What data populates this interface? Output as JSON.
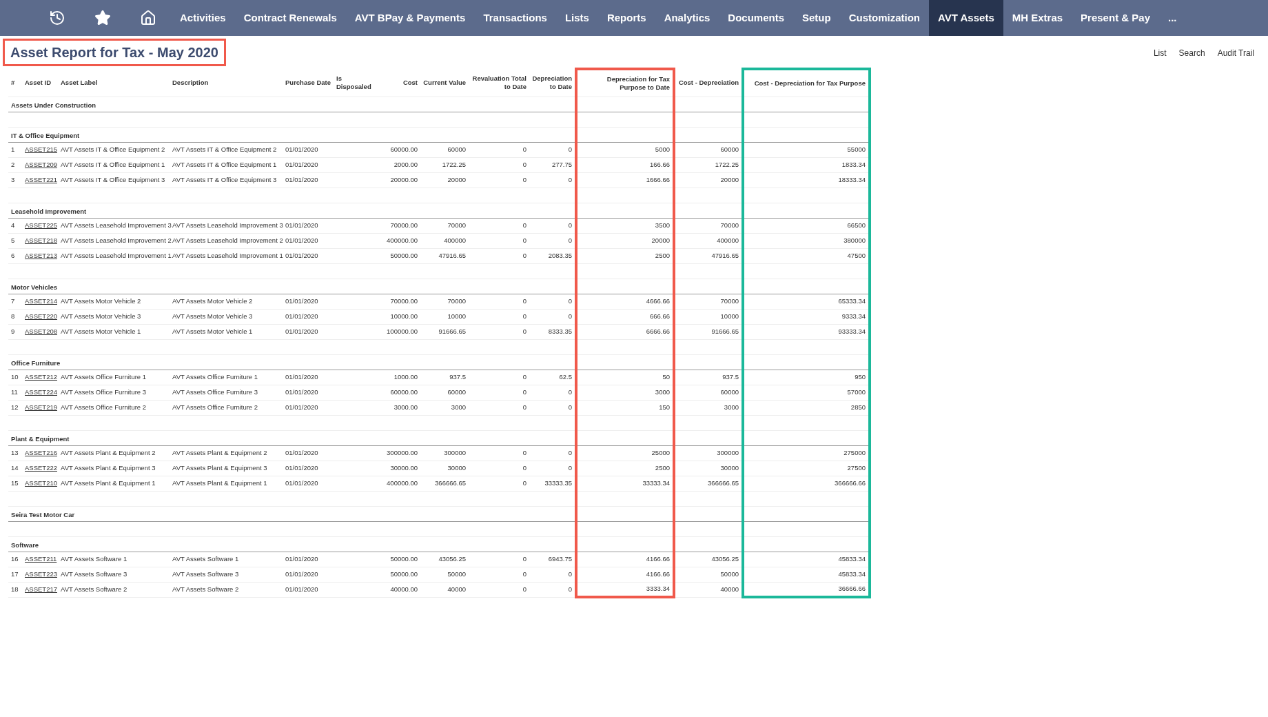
{
  "nav": {
    "icons": [
      {
        "kind": "history"
      },
      {
        "kind": "star"
      },
      {
        "kind": "home"
      }
    ],
    "items": [
      {
        "label": "Activities",
        "selected": false
      },
      {
        "label": "Contract Renewals",
        "selected": false
      },
      {
        "label": "AVT BPay & Payments",
        "selected": false
      },
      {
        "label": "Transactions",
        "selected": false
      },
      {
        "label": "Lists",
        "selected": false
      },
      {
        "label": "Reports",
        "selected": false
      },
      {
        "label": "Analytics",
        "selected": false
      },
      {
        "label": "Documents",
        "selected": false
      },
      {
        "label": "Setup",
        "selected": false
      },
      {
        "label": "Customization",
        "selected": false
      },
      {
        "label": "AVT Assets",
        "selected": true
      },
      {
        "label": "MH Extras",
        "selected": false
      },
      {
        "label": "Present & Pay",
        "selected": false
      },
      {
        "label": "...",
        "selected": false
      }
    ]
  },
  "title": {
    "text": "Asset Report for Tax - May 2020",
    "outlined": true
  },
  "links": [
    "List",
    "Search",
    "Audit Trail"
  ],
  "table": {
    "columns": [
      {
        "label": "#",
        "kind": "text"
      },
      {
        "label": "Asset ID",
        "kind": "link"
      },
      {
        "label": "Asset Label",
        "kind": "text"
      },
      {
        "label": "Description",
        "kind": "text"
      },
      {
        "label": "Purchase Date",
        "kind": "text"
      },
      {
        "label": "Is Disposaled",
        "kind": "text"
      },
      {
        "label": "Cost",
        "kind": "number"
      },
      {
        "label": "Current Value",
        "kind": "number"
      },
      {
        "label": "Revaluation Total to Date",
        "kind": "number"
      },
      {
        "label": "Depreciation to Date",
        "kind": "number"
      },
      {
        "label": "Depreciation for Tax Purpose to Date",
        "kind": "number",
        "color": "#f0594b"
      },
      {
        "label": "Cost - Depreciation",
        "kind": "number"
      },
      {
        "label": "Cost - Depreciation for Tax Purpose",
        "kind": "number",
        "color": "#1bb89a"
      }
    ],
    "groups": [
      {
        "name": "Assets Under Construction"
      },
      {
        "name": "IT & Office Equipment",
        "rows": [
          [
            "1",
            "ASSET215",
            "AVT Assets IT & Office Equipment 2",
            "AVT Assets IT & Office Equipment 2",
            "01/01/2020",
            "",
            "60000.00",
            "60000",
            "0",
            "0",
            "5000",
            "60000",
            "55000"
          ],
          [
            "2",
            "ASSET209",
            "AVT Assets IT & Office Equipment 1",
            "AVT Assets IT & Office Equipment 1",
            "01/01/2020",
            "",
            "2000.00",
            "1722.25",
            "0",
            "277.75",
            "166.66",
            "1722.25",
            "1833.34"
          ],
          [
            "3",
            "ASSET221",
            "AVT Assets IT & Office Equipment 3",
            "AVT Assets IT & Office Equipment 3",
            "01/01/2020",
            "",
            "20000.00",
            "20000",
            "0",
            "0",
            "1666.66",
            "20000",
            "18333.34"
          ]
        ]
      },
      {
        "name": "Leasehold Improvement",
        "rows": [
          [
            "4",
            "ASSET225",
            "AVT Assets Leasehold Improvement 3",
            "AVT Assets Leasehold Improvement 3",
            "01/01/2020",
            "",
            "70000.00",
            "70000",
            "0",
            "0",
            "3500",
            "70000",
            "66500"
          ],
          [
            "5",
            "ASSET218",
            "AVT Assets Leasehold Improvement 2",
            "AVT Assets Leasehold Improvement 2",
            "01/01/2020",
            "",
            "400000.00",
            "400000",
            "0",
            "0",
            "20000",
            "400000",
            "380000"
          ],
          [
            "6",
            "ASSET213",
            "AVT Assets Leasehold Improvement 1",
            "AVT Assets Leasehold Improvement 1",
            "01/01/2020",
            "",
            "50000.00",
            "47916.65",
            "0",
            "2083.35",
            "2500",
            "47916.65",
            "47500"
          ]
        ]
      },
      {
        "name": "Motor Vehicles",
        "rows": [
          [
            "7",
            "ASSET214",
            "AVT Assets Motor Vehicle 2",
            "AVT Assets Motor Vehicle 2",
            "01/01/2020",
            "",
            "70000.00",
            "70000",
            "0",
            "0",
            "4666.66",
            "70000",
            "65333.34"
          ],
          [
            "8",
            "ASSET220",
            "AVT Assets Motor Vehicle 3",
            "AVT Assets Motor Vehicle 3",
            "01/01/2020",
            "",
            "10000.00",
            "10000",
            "0",
            "0",
            "666.66",
            "10000",
            "9333.34"
          ],
          [
            "9",
            "ASSET208",
            "AVT Assets Motor Vehicle 1",
            "AVT Assets Motor Vehicle 1",
            "01/01/2020",
            "",
            "100000.00",
            "91666.65",
            "0",
            "8333.35",
            "6666.66",
            "91666.65",
            "93333.34"
          ]
        ]
      },
      {
        "name": "Office Furniture",
        "rows": [
          [
            "10",
            "ASSET212",
            "AVT Assets Office Furniture 1",
            "AVT Assets Office Furniture 1",
            "01/01/2020",
            "",
            "1000.00",
            "937.5",
            "0",
            "62.5",
            "50",
            "937.5",
            "950"
          ],
          [
            "11",
            "ASSET224",
            "AVT Assets Office Furniture 3",
            "AVT Assets Office Furniture 3",
            "01/01/2020",
            "",
            "60000.00",
            "60000",
            "0",
            "0",
            "3000",
            "60000",
            "57000"
          ],
          [
            "12",
            "ASSET219",
            "AVT Assets Office Furniture 2",
            "AVT Assets Office Furniture 2",
            "01/01/2020",
            "",
            "3000.00",
            "3000",
            "0",
            "0",
            "150",
            "3000",
            "2850"
          ]
        ]
      },
      {
        "name": "Plant & Equipment",
        "rows": [
          [
            "13",
            "ASSET216",
            "AVT Assets Plant & Equipment 2",
            "AVT Assets Plant & Equipment 2",
            "01/01/2020",
            "",
            "300000.00",
            "300000",
            "0",
            "0",
            "25000",
            "300000",
            "275000"
          ],
          [
            "14",
            "ASSET222",
            "AVT Assets Plant & Equipment 3",
            "AVT Assets Plant & Equipment 3",
            "01/01/2020",
            "",
            "30000.00",
            "30000",
            "0",
            "0",
            "2500",
            "30000",
            "27500"
          ],
          [
            "15",
            "ASSET210",
            "AVT Assets Plant & Equipment 1",
            "AVT Assets Plant & Equipment 1",
            "01/01/2020",
            "",
            "400000.00",
            "366666.65",
            "0",
            "33333.35",
            "33333.34",
            "366666.65",
            "366666.66"
          ]
        ]
      },
      {
        "name": "Seira Test Motor Car"
      },
      {
        "name": "Software",
        "rows": [
          [
            "16",
            "ASSET211",
            "AVT Assets Software 1",
            "AVT Assets Software 1",
            "01/01/2020",
            "",
            "50000.00",
            "43056.25",
            "0",
            "6943.75",
            "4166.66",
            "43056.25",
            "45833.34"
          ],
          [
            "17",
            "ASSET223",
            "AVT Assets Software 3",
            "AVT Assets Software 3",
            "01/01/2020",
            "",
            "50000.00",
            "50000",
            "0",
            "0",
            "4166.66",
            "50000",
            "45833.34"
          ],
          [
            "18",
            "ASSET217",
            "AVT Assets Software 2",
            "AVT Assets Software 2",
            "01/01/2020",
            "",
            "40000.00",
            "40000",
            "0",
            "0",
            "3333.34",
            "40000",
            "36666.66"
          ]
        ]
      }
    ]
  }
}
